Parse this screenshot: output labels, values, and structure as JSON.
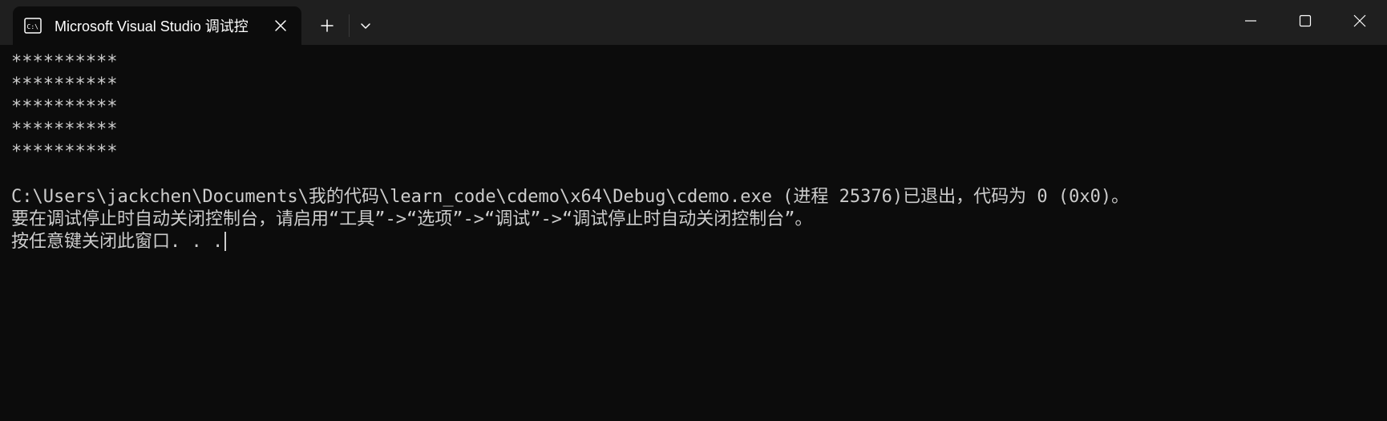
{
  "window": {
    "tab_title": "Microsoft Visual Studio 调试控",
    "tab_icon": "console-app-icon",
    "colors": {
      "titlebar_bg": "#1f1f1f",
      "console_bg": "#0c0c0c",
      "console_text": "#cccccc",
      "title_text": "#ffffff"
    }
  },
  "toolbar": {
    "new_tab_icon": "plus-icon",
    "dropdown_icon": "chevron-down-icon"
  },
  "window_controls": {
    "minimize_icon": "minimize-icon",
    "maximize_icon": "maximize-icon",
    "close_icon": "close-icon"
  },
  "console": {
    "lines": [
      "**********",
      "**********",
      "**********",
      "**********",
      "**********",
      "",
      "C:\\Users\\jackchen\\Documents\\我的代码\\learn_code\\cdemo\\x64\\Debug\\cdemo.exe (进程 25376)已退出，代码为 0 (0x0)。",
      "要在调试停止时自动关闭控制台，请启用“工具”->“选项”->“调试”->“调试停止时自动关闭控制台”。",
      "按任意键关闭此窗口. . ."
    ]
  }
}
